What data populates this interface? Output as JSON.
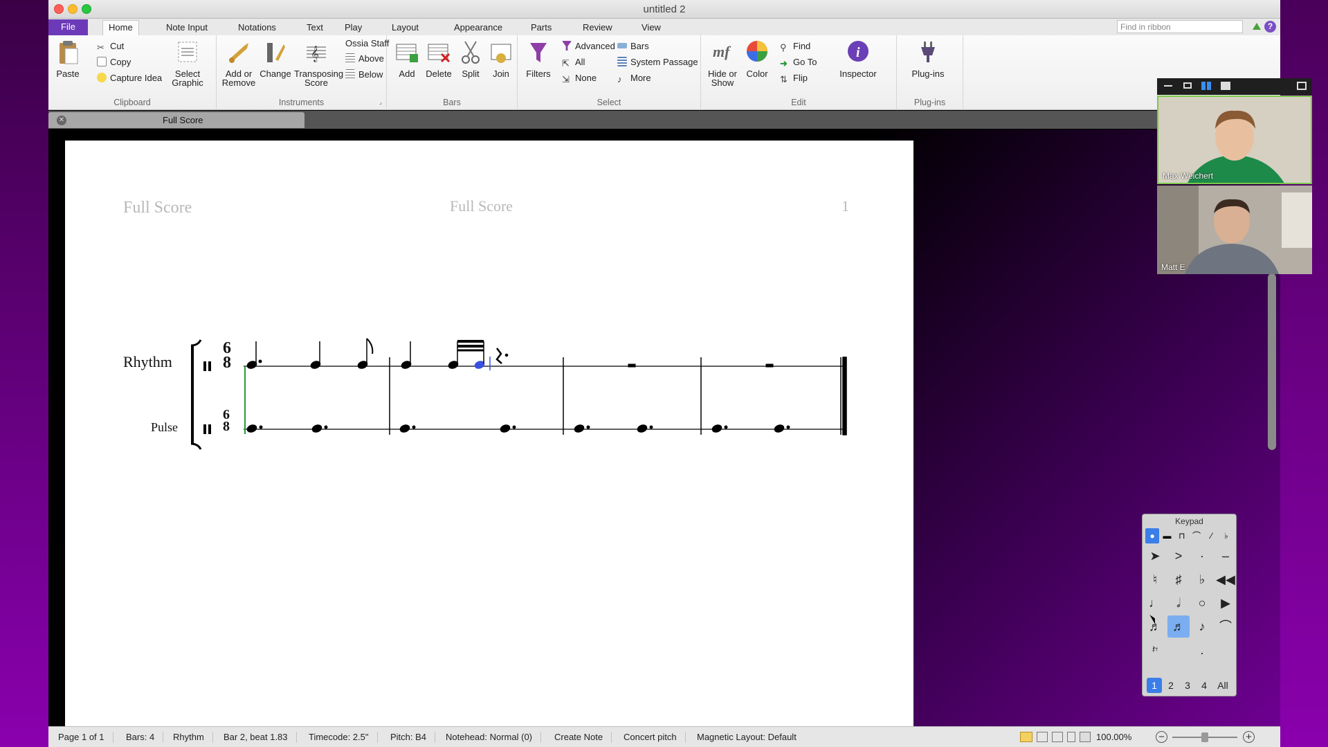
{
  "window": {
    "title": "untitled 2"
  },
  "ribbon_tabs": [
    "File",
    "Home",
    "Note Input",
    "Notations",
    "Text",
    "Play",
    "Layout",
    "Appearance",
    "Parts",
    "Review",
    "View"
  ],
  "find_placeholder": "Find in ribbon",
  "clipboard": {
    "paste": "Paste",
    "cut": "Cut",
    "copy": "Copy",
    "capture": "Capture Idea",
    "select_graphic": "Select Graphic",
    "label": "Clipboard"
  },
  "instruments": {
    "add_remove": "Add or Remove",
    "change": "Change",
    "transposing": "Transposing Score",
    "ossia": "Ossia Staff",
    "above": "Above",
    "below": "Below",
    "label": "Instruments"
  },
  "bars": {
    "add": "Add",
    "delete": "Delete",
    "split": "Split",
    "join": "Join",
    "label": "Bars"
  },
  "select": {
    "filters": "Filters",
    "advanced": "Advanced",
    "all": "All",
    "none": "None",
    "bars": "Bars",
    "system_passage": "System Passage",
    "more": "More",
    "label": "Select"
  },
  "edit": {
    "hide_show": "Hide or Show",
    "color": "Color",
    "find": "Find",
    "goto": "Go To",
    "flip": "Flip",
    "inspector": "Inspector",
    "label": "Edit"
  },
  "plugins": {
    "plugins": "Plug-ins",
    "label": "Plug-ins"
  },
  "doc_tab": "Full Score",
  "score": {
    "header_left": "Full Score",
    "header_center": "Full Score",
    "page_number": "1",
    "staff1": "Rhythm",
    "staff2": "Pulse",
    "time_top": "6",
    "time_bottom": "8"
  },
  "status": [
    "Page 1 of 1",
    "Bars: 4",
    "Rhythm",
    "Bar 2, beat 1.83",
    "Timecode: 2.5\"",
    "Pitch: B4",
    "Notehead: Normal (0)",
    "Create Note",
    "Concert pitch",
    "Magnetic Layout: Default"
  ],
  "zoom": "100.00%",
  "video": [
    {
      "name": "Max Weichert"
    },
    {
      "name": "Matt E"
    }
  ],
  "keypad": {
    "title": "Keypad",
    "pages": [
      "1",
      "2",
      "3",
      "4",
      "All"
    ],
    "selected_page": "1"
  }
}
